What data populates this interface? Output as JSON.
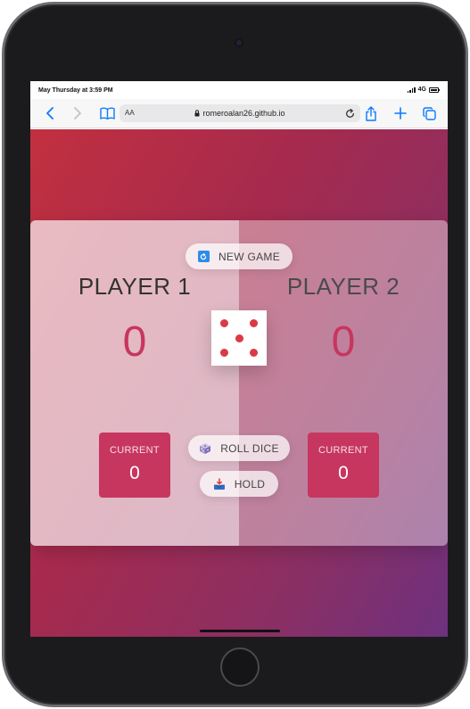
{
  "status_bar": {
    "time": "May Thursday at 3:59 PM",
    "network": "4G"
  },
  "browser": {
    "text_size_button": "AA",
    "url": "romeroalan26.github.io",
    "icons": [
      "back-icon",
      "forward-icon",
      "bookmarks-icon",
      "lock-icon",
      "reload-icon",
      "share-icon",
      "add-tab-icon",
      "tabs-icon"
    ]
  },
  "game": {
    "new_game_label": "NEW GAME",
    "roll_dice_label": "ROLL DICE",
    "hold_label": "HOLD",
    "dice_value": 5,
    "players": [
      {
        "name": "PLAYER 1",
        "score": "0",
        "current_label": "CURRENT",
        "current_score": "0",
        "active": true
      },
      {
        "name": "PLAYER 2",
        "score": "0",
        "current_label": "CURRENT",
        "current_score": "0",
        "active": false
      }
    ]
  },
  "colors": {
    "accent": "#c7365f",
    "dice_pip": "#d93b45",
    "safari_blue": "#0a7aff"
  }
}
